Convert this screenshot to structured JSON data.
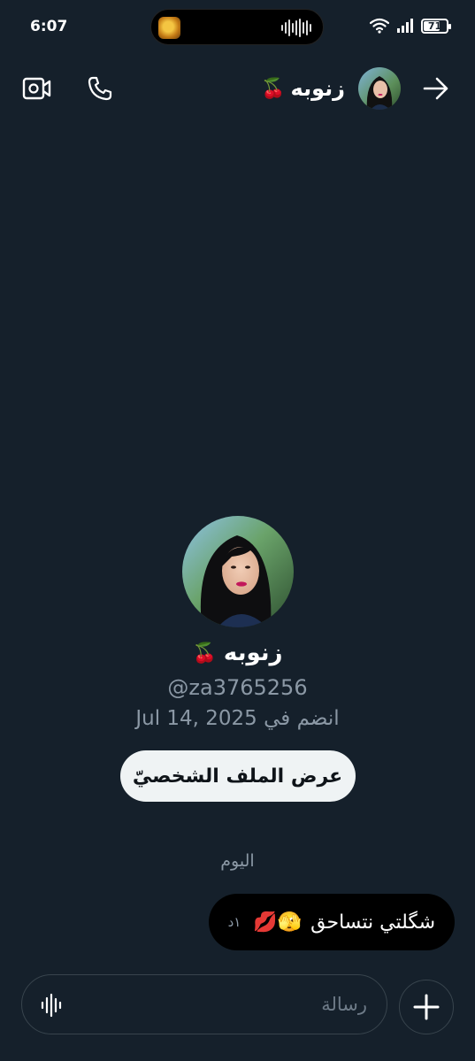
{
  "status_bar": {
    "time": "6:07",
    "battery": "71",
    "battery_level_percent": 71,
    "icons": [
      "wifi-icon",
      "signal-icon",
      "battery-icon"
    ]
  },
  "header": {
    "name": "زنوبه",
    "name_emoji": "🍒",
    "icons": [
      "back-arrow-icon",
      "video-call-icon",
      "phone-icon"
    ]
  },
  "profile": {
    "name": "زنوبه",
    "name_emoji": "🍒",
    "handle": "@za3765256",
    "joined": "انضم في Jul 14, 2025",
    "view_profile_label": "عرض الملف الشخصيّ"
  },
  "conversation": {
    "date_divider": "اليوم",
    "messages": [
      {
        "text": "شگلتي نتساحق",
        "emojis": "🫣💋",
        "time": "١د"
      }
    ]
  },
  "composer": {
    "placeholder": "رسالة"
  },
  "colors": {
    "background": "#15202b",
    "secondary_text": "#8b98a5",
    "bubble": "#000000",
    "button_light": "#eff3f4"
  }
}
